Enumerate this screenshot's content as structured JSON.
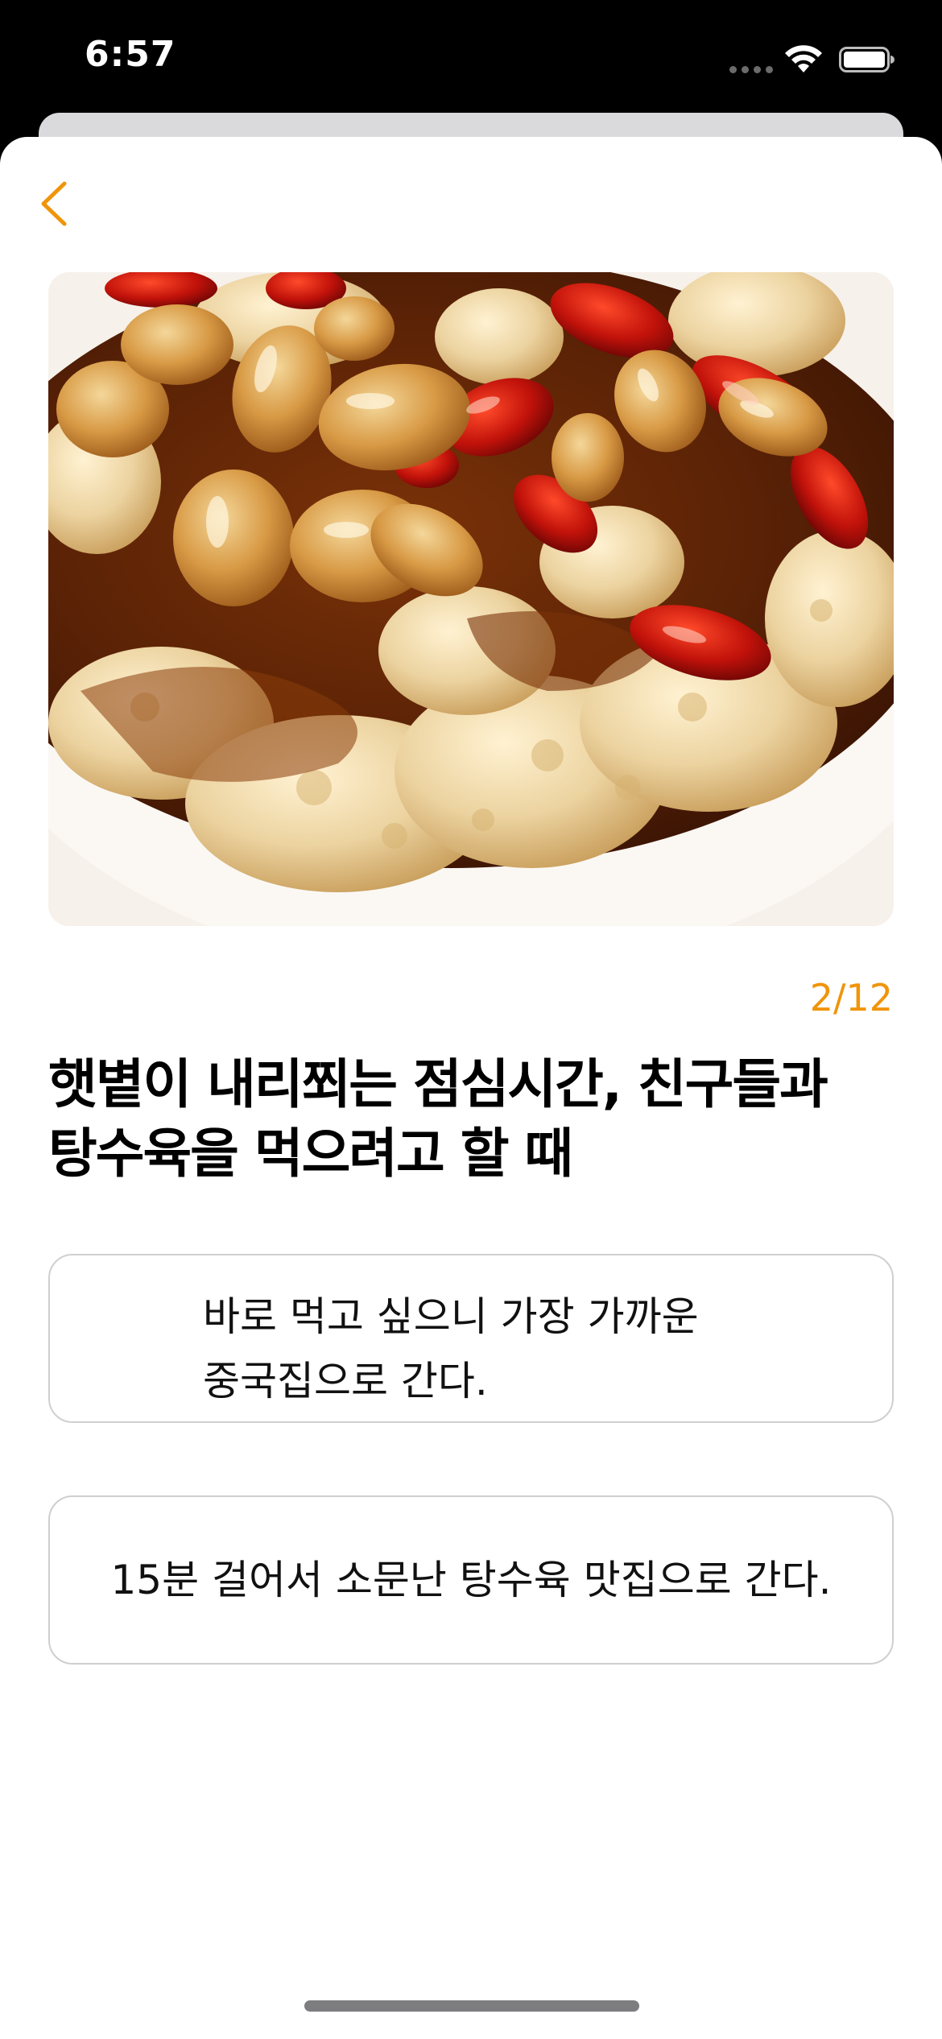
{
  "status_bar": {
    "time": "6:57"
  },
  "colors": {
    "accent": "#f0940a",
    "option_border": "#cfcfd2",
    "text": "#000000"
  },
  "icons": {
    "back": "chevron-left-icon",
    "wifi": "wifi-icon",
    "battery": "battery-icon"
  },
  "quiz": {
    "progress": "2/12",
    "question_line1": "햇볕이 내리쬐는 점심시간, 친구들과",
    "question_line2": "탕수육을 먹으려고 할 때",
    "options": [
      {
        "line1": "바로 먹고 싶으니 가장 가까운",
        "line2": "중국집으로 간다."
      },
      {
        "label": "15분 걸어서 소문난 탕수육 맛집으로 간다."
      }
    ]
  }
}
